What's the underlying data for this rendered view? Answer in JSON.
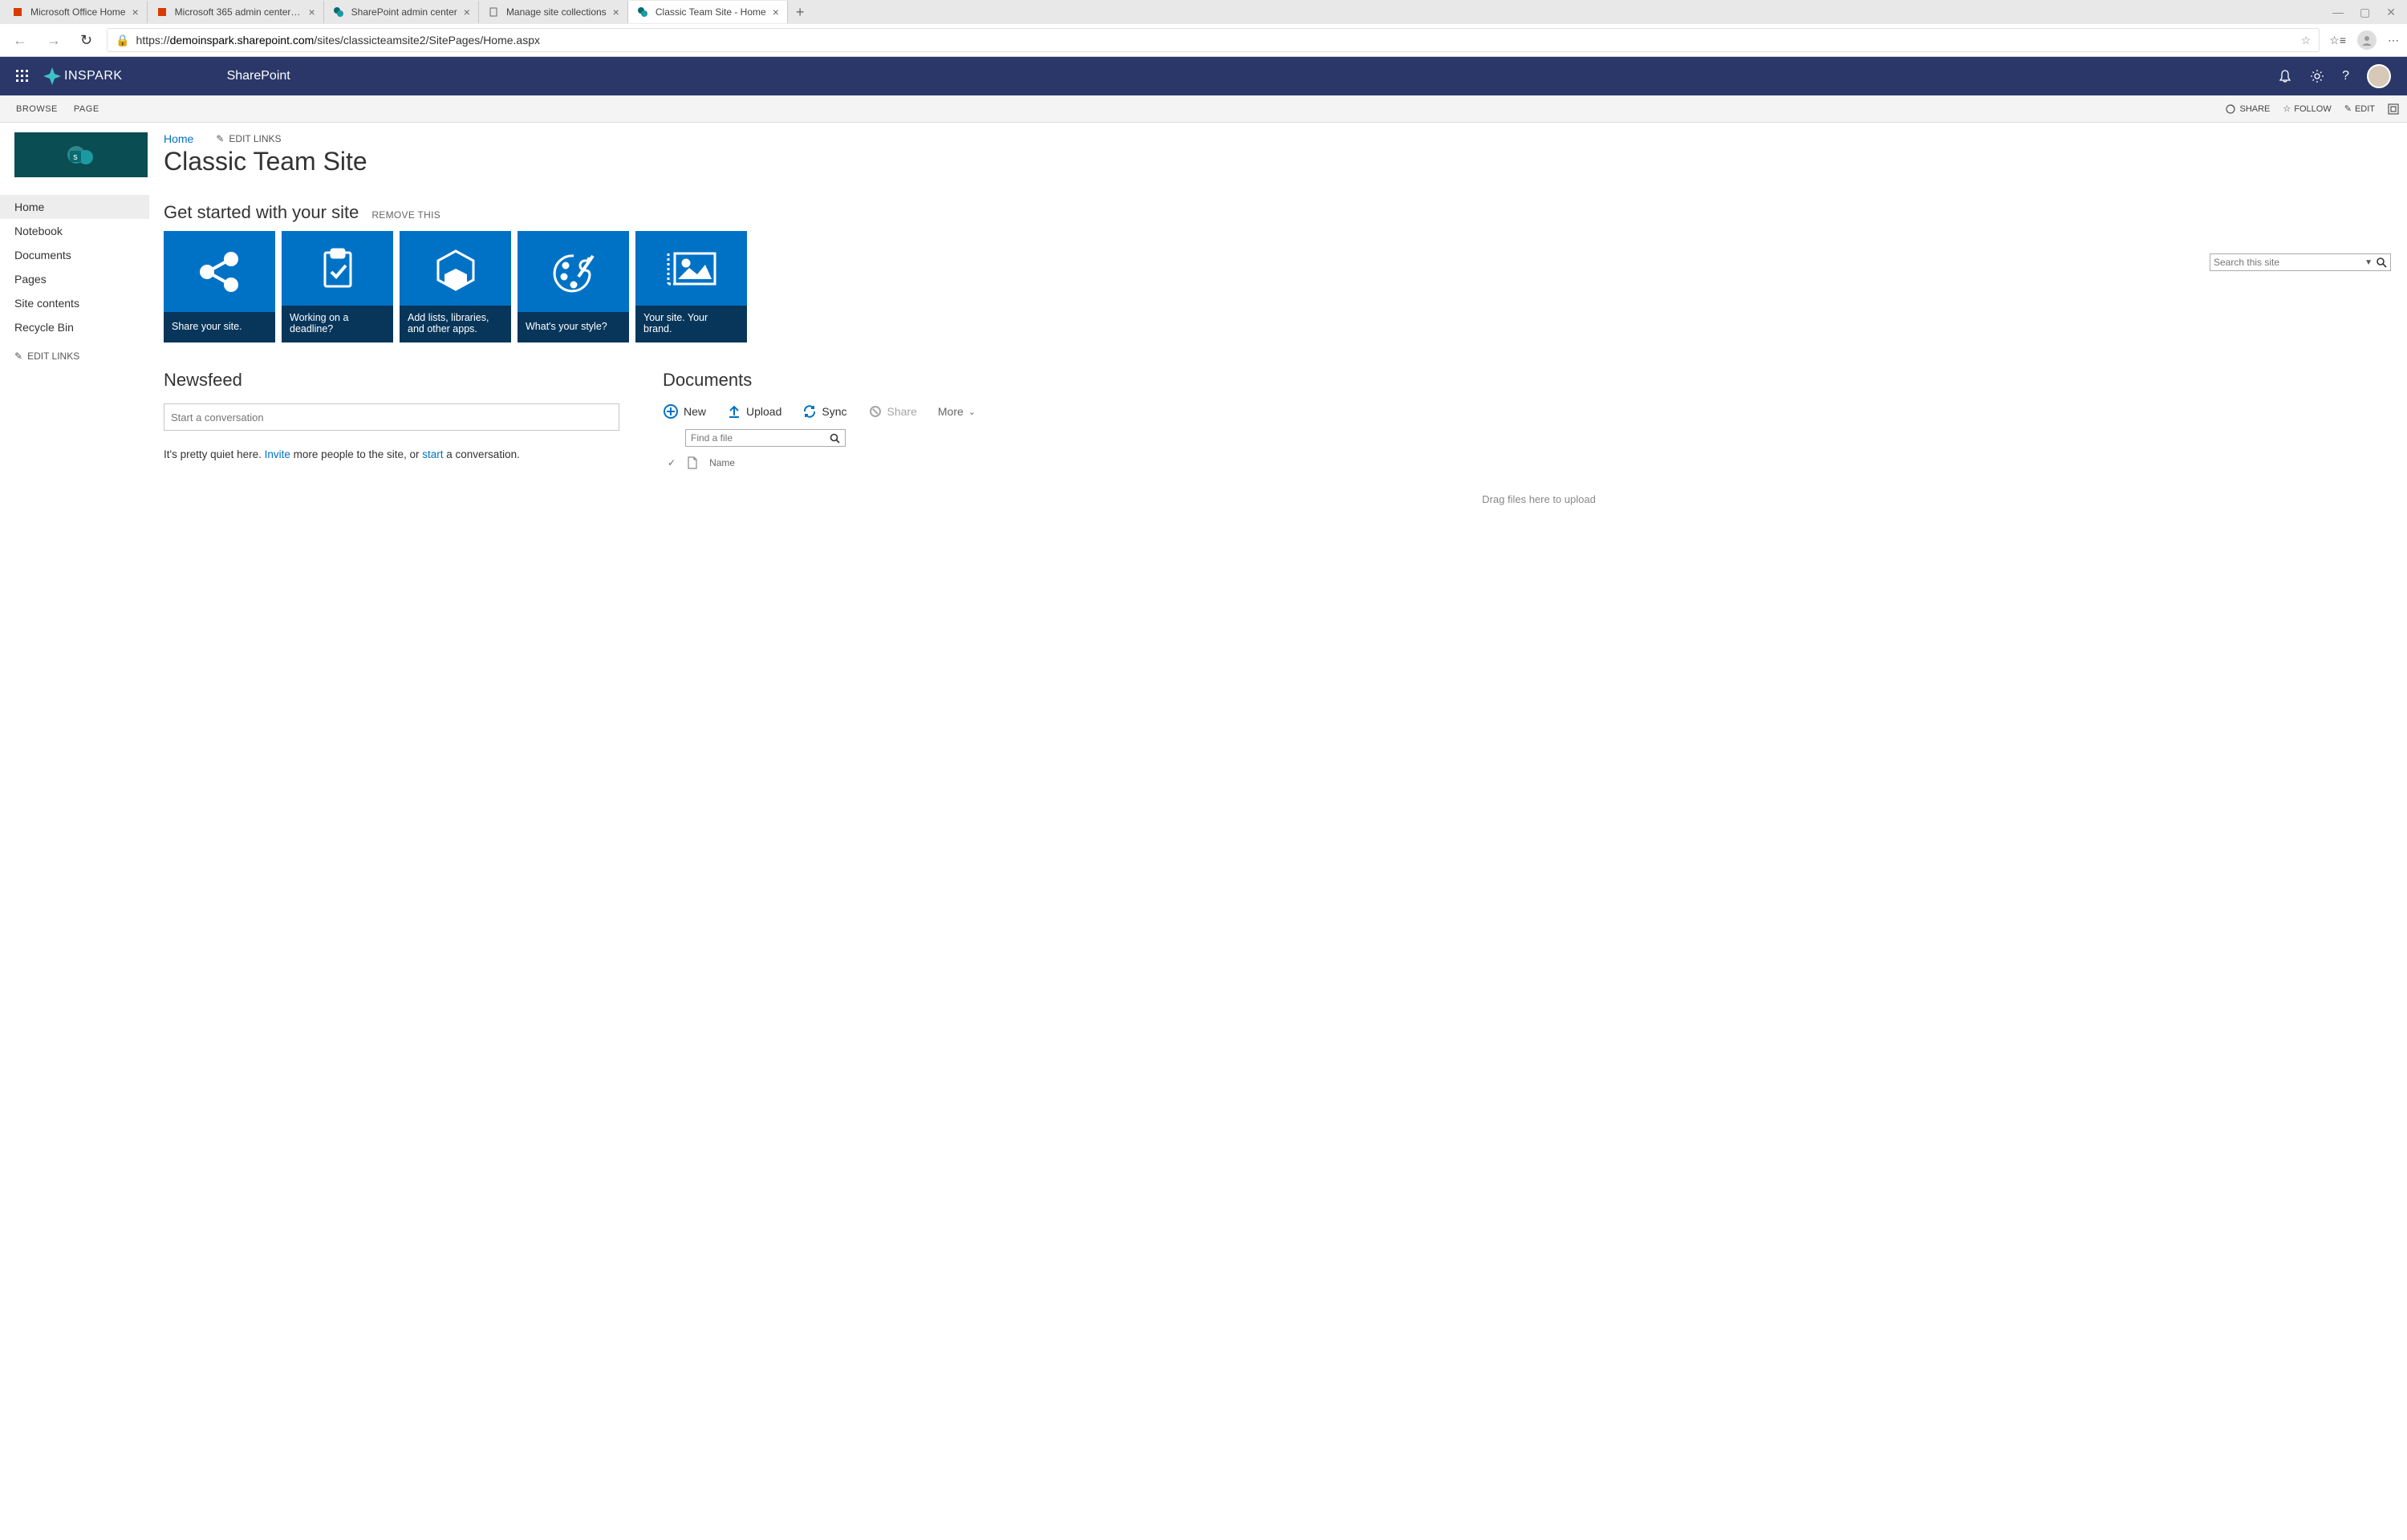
{
  "browser": {
    "tabs": [
      {
        "label": "Microsoft Office Home"
      },
      {
        "label": "Microsoft 365 admin center - M…"
      },
      {
        "label": "SharePoint admin center"
      },
      {
        "label": "Manage site collections"
      },
      {
        "label": "Classic Team Site - Home"
      }
    ],
    "url_host": "demoinspark.sharepoint.com",
    "url_path": "/sites/classicteamsite2/SitePages/Home.aspx",
    "url_prefix": "https://"
  },
  "suite": {
    "brand": "INSPARK",
    "app": "SharePoint"
  },
  "ribbon": {
    "tabs": [
      "BROWSE",
      "PAGE"
    ],
    "actions": {
      "share": "SHARE",
      "follow": "FOLLOW",
      "edit": "EDIT"
    }
  },
  "breadcrumb": {
    "home": "Home",
    "edit_links": "EDIT LINKS"
  },
  "page_title": "Classic Team Site",
  "search": {
    "placeholder": "Search this site"
  },
  "nav": {
    "items": [
      "Home",
      "Notebook",
      "Documents",
      "Pages",
      "Site contents",
      "Recycle Bin"
    ],
    "edit_links": "EDIT LINKS"
  },
  "get_started": {
    "title": "Get started with your site",
    "remove": "REMOVE THIS",
    "tiles": [
      {
        "caption": "Share your site."
      },
      {
        "caption": "Working on a deadline?"
      },
      {
        "caption": "Add lists, libraries, and other apps."
      },
      {
        "caption": "What's your style?"
      },
      {
        "caption": "Your site. Your brand."
      }
    ]
  },
  "newsfeed": {
    "title": "Newsfeed",
    "placeholder": "Start a conversation",
    "quiet_prefix": "It's pretty quiet here. ",
    "invite": "Invite",
    "quiet_mid": " more people to the site, or ",
    "start": "start",
    "quiet_suffix": " a conversation."
  },
  "documents": {
    "title": "Documents",
    "toolbar": {
      "new": "New",
      "upload": "Upload",
      "sync": "Sync",
      "share": "Share",
      "more": "More"
    },
    "find_placeholder": "Find a file",
    "col_name": "Name",
    "drop_text": "Drag files here to upload"
  }
}
